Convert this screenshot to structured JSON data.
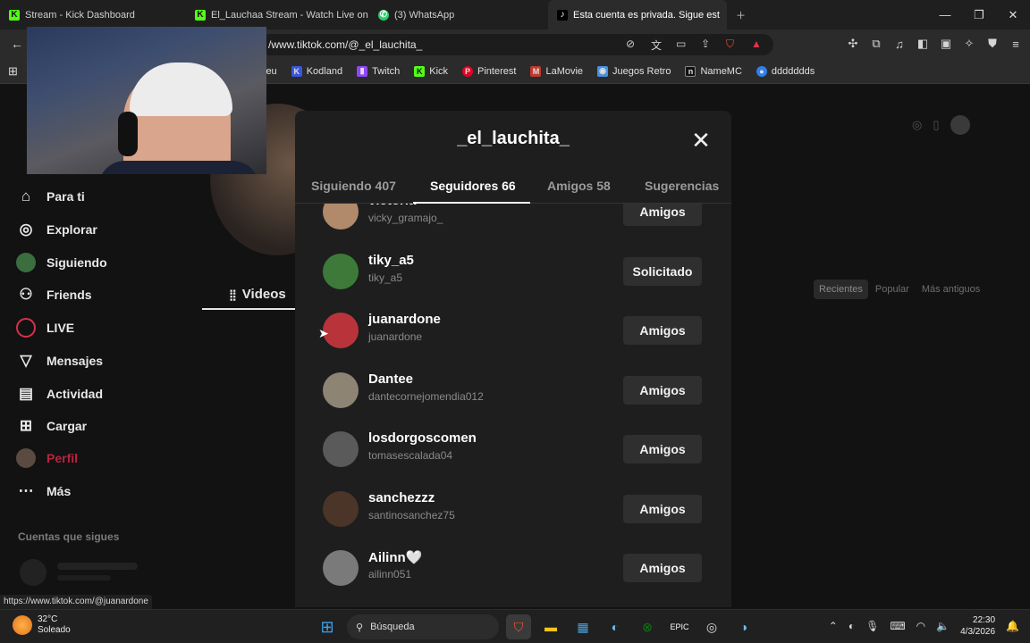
{
  "browser": {
    "tabs": [
      {
        "label": "Stream - Kick Dashboard",
        "icon": "kick-icon"
      },
      {
        "label": "El_Lauchaa Stream - Watch Live on Ki",
        "icon": "kick-icon"
      },
      {
        "label": "(3) WhatsApp",
        "icon": "whatsapp-icon"
      },
      {
        "label": "Esta cuenta es privada. Sigue est",
        "icon": "tiktok-icon",
        "active": true
      }
    ],
    "url": "/www.tiktok.com/@_el_lauchita_",
    "bookmarks": [
      {
        "label": "leu",
        "color": "#2b2b2b"
      },
      {
        "label": "Kodland",
        "color": "#3b56d9"
      },
      {
        "label": "Twitch",
        "color": "#9146ff"
      },
      {
        "label": "Kick",
        "color": "#53fc18"
      },
      {
        "label": "Pinterest",
        "color": "#e60023"
      },
      {
        "label": "LaMovie",
        "color": "#c0392b"
      },
      {
        "label": "Juegos Retro",
        "color": "#4a90e2"
      },
      {
        "label": "NameMC",
        "color": "#111111"
      },
      {
        "label": "ddddddds",
        "color": "#2f80ed"
      }
    ]
  },
  "sidebar": {
    "items": [
      {
        "label": "Para ti",
        "icon": "home-icon"
      },
      {
        "label": "Explorar",
        "icon": "compass-icon"
      },
      {
        "label": "Siguiendo",
        "icon": "following-icon"
      },
      {
        "label": "Friends",
        "icon": "friends-icon"
      },
      {
        "label": "LIVE",
        "icon": "live-icon"
      },
      {
        "label": "Mensajes",
        "icon": "messages-icon"
      },
      {
        "label": "Actividad",
        "icon": "activity-icon"
      },
      {
        "label": "Cargar",
        "icon": "upload-icon"
      },
      {
        "label": "Perfil",
        "icon": "profile-icon"
      },
      {
        "label": "Más",
        "icon": "more-icon"
      }
    ],
    "following_title": "Cuentas que sigues"
  },
  "profile": {
    "videos_tab": "Videos",
    "sort": [
      "Recientes",
      "Popular",
      "Más antiguos"
    ]
  },
  "modal": {
    "title": "_el_lauchita_",
    "tabs": [
      {
        "label": "Siguiendo 407"
      },
      {
        "label": "Seguidores 66",
        "active": true
      },
      {
        "label": "Amigos 58"
      },
      {
        "label": "Sugerencias"
      }
    ],
    "users": [
      {
        "name": "victoria",
        "handle": "vicky_gramajo_",
        "action": "Amigos",
        "avatar_color": "#b08a6a"
      },
      {
        "name": "tiky_a5",
        "handle": "tiky_a5",
        "action": "Solicitado",
        "avatar_color": "#3d7a3a"
      },
      {
        "name": "juanardone",
        "handle": "juanardone",
        "action": "Amigos",
        "avatar_color": "#b8343a"
      },
      {
        "name": "Dantee",
        "handle": "dantecornejomendia012",
        "action": "Amigos",
        "avatar_color": "#8d8474"
      },
      {
        "name": "losdorgoscomen",
        "handle": "tomasescalada04",
        "action": "Amigos",
        "avatar_color": "#5a5a5a"
      },
      {
        "name": "sanchezzz",
        "handle": "santinosanchez75",
        "action": "Amigos",
        "avatar_color": "#4b3528"
      },
      {
        "name": "Ailinn🤍",
        "handle": "ailinn051",
        "action": "Amigos",
        "avatar_color": "#7a7a7a"
      }
    ]
  },
  "status_url": "https://www.tiktok.com/@juanardone",
  "taskbar": {
    "weather_temp": "32°C",
    "weather_desc": "Soleado",
    "search": "Búsqueda",
    "time": "22:30",
    "date": "4/3/2026"
  }
}
